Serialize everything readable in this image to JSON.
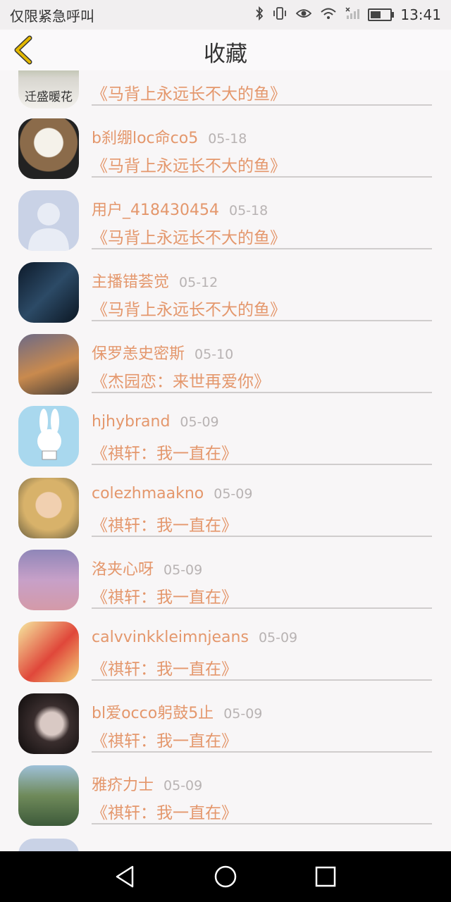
{
  "status_bar": {
    "carrier": "仅限紧急呼叫",
    "time": "13:41",
    "icons": [
      "bluetooth-icon",
      "vibrate-icon",
      "eye-icon",
      "wifi-icon",
      "no-signal-icon",
      "battery-icon"
    ]
  },
  "header": {
    "title": "收藏",
    "back_icon": "chevron-left-icon",
    "accent_color": "#e3b800"
  },
  "colors": {
    "name": "#e4976c",
    "date": "#b8b3b3",
    "divider": "#d0cdcd",
    "background": "#f8f6f7"
  },
  "partial_top_item": {
    "avatar_text": "迁盛暖花",
    "book": "《马背上永远长不大的鱼》"
  },
  "items": [
    {
      "name": "b刹绷loc命co5",
      "date": "05-18",
      "book": "《马背上永远长不大的鱼》"
    },
    {
      "name": "用户_418430454",
      "date": "05-18",
      "book": "《马背上永远长不大的鱼》"
    },
    {
      "name": "主播错荟觉",
      "date": "05-12",
      "book": "《马背上永远长不大的鱼》"
    },
    {
      "name": "保罗恙史密斯",
      "date": "05-10",
      "book": "《杰园恋：来世再爱你》"
    },
    {
      "name": "hjhybrand",
      "date": "05-09",
      "book": "《祺轩：我一直在》"
    },
    {
      "name": "colezhmaakno",
      "date": "05-09",
      "book": "《祺轩：我一直在》"
    },
    {
      "name": "洛夹心呀",
      "date": "05-09",
      "book": "《祺轩：我一直在》"
    },
    {
      "name": "calvvinkkleimnjeans",
      "date": "05-09",
      "book": "《祺轩：我一直在》"
    },
    {
      "name": "bl爱occo躬鼓5止",
      "date": "05-09",
      "book": "《祺轩：我一直在》"
    },
    {
      "name": "雅疥力士",
      "date": "05-09",
      "book": "《祺轩：我一直在》"
    }
  ],
  "nav": {
    "back_icon": "triangle-back-icon",
    "home_icon": "circle-home-icon",
    "recents_icon": "square-recents-icon"
  }
}
